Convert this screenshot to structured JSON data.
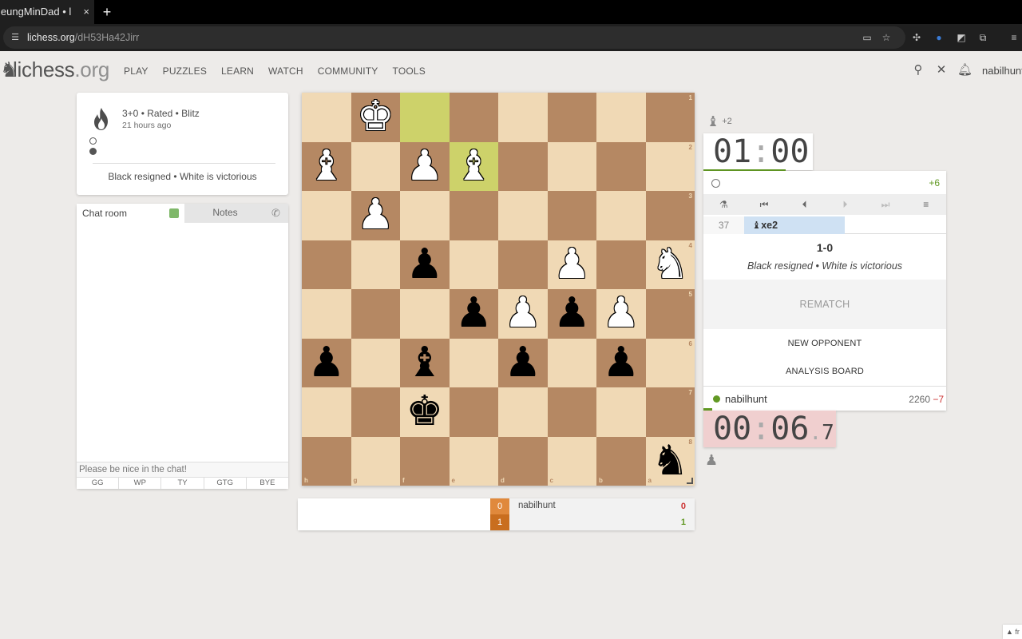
{
  "browser": {
    "tab_title": "leungMinDad • l",
    "tab_close": "×",
    "new_tab": "+",
    "url_domain": "lichess.org",
    "url_path": "/dH53Ha42Jirr"
  },
  "header": {
    "logo_main": "lichess",
    "logo_tld": ".org",
    "nav": [
      "PLAY",
      "PUZZLES",
      "LEARN",
      "WATCH",
      "COMMUNITY",
      "TOOLS"
    ],
    "username": "nabilhunt"
  },
  "game_info": {
    "type": "3+0 • Rated • Blitz",
    "time_ago": "21 hours ago",
    "result": "Black resigned • White is victorious"
  },
  "chat": {
    "tab_room": "Chat room",
    "tab_notes": "Notes",
    "placeholder": "Please be nice in the chat!",
    "presets": [
      "GG",
      "WP",
      "TY",
      "GTG",
      "BYE"
    ]
  },
  "board": {
    "orientation": "black",
    "rank_labels": [
      "1",
      "2",
      "3",
      "4",
      "5",
      "6",
      "7",
      "8"
    ],
    "file_labels": [
      "h",
      "g",
      "f",
      "e",
      "d",
      "c",
      "b",
      "a"
    ],
    "colors": {
      "light": "#f0d9b5",
      "dark": "#b58863",
      "highlight": "#cdd26a"
    }
  },
  "crosstable": {
    "scores_left": [
      "0",
      "1"
    ],
    "opponent": "nabilhunt",
    "score_loss": "0",
    "score_win": "1"
  },
  "right": {
    "material_top": "+2",
    "clock_top_min": "01",
    "clock_top_sec": "00",
    "material_diff": "+6",
    "move_number": "37",
    "move_san": "♝xe2",
    "score": "1-0",
    "status": "Black resigned • White is victorious",
    "rematch": "REMATCH",
    "new_opponent": "NEW OPPONENT",
    "analysis_board": "ANALYSIS BOARD",
    "player": "nabilhunt",
    "rating": "2260",
    "rating_diff": "−7",
    "clock_bot_min": "00",
    "clock_bot_sec": "06",
    "clock_bot_tenths": "7"
  },
  "corner": "▲ fr"
}
